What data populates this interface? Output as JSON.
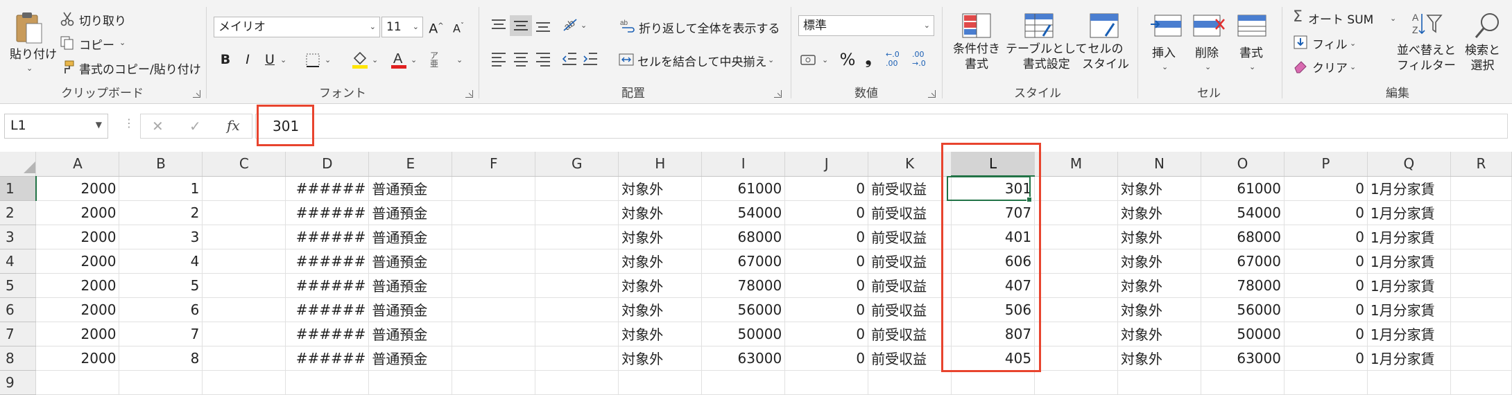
{
  "ribbon": {
    "clipboard": {
      "paste": "貼り付け",
      "cut": "切り取り",
      "copy": "コピー",
      "format_painter": "書式のコピー/貼り付け",
      "group_label": "クリップボード"
    },
    "font": {
      "font_name": "メイリオ",
      "font_size": "11",
      "bold": "B",
      "italic": "I",
      "underline": "U",
      "phonetic": "ア亜",
      "group_label": "フォント"
    },
    "alignment": {
      "wrap_text": "折り返して全体を表示する",
      "merge_center": "セルを結合して中央揃え",
      "group_label": "配置"
    },
    "number": {
      "format": "標準",
      "percent": "%",
      "comma": "❟",
      "inc_decimal": "←.0\n.00",
      "dec_decimal": ".00\n→.0",
      "group_label": "数値"
    },
    "styles": {
      "conditional": "条件付き\n書式",
      "table": "テーブルとして\n書式設定",
      "cell_style": "セルの\nスタイル",
      "group_label": "スタイル"
    },
    "cells": {
      "insert": "挿入",
      "delete": "削除",
      "format": "書式",
      "group_label": "セル"
    },
    "editing": {
      "autosum": "オート SUM",
      "fill": "フィル",
      "clear": "クリア",
      "sort_filter": "並べ替えと\nフィルター",
      "find_select": "検索と\n選択",
      "group_label": "編集"
    }
  },
  "formula_bar": {
    "name_box": "L1",
    "cancel": "✕",
    "enter": "✓",
    "fx": "fx",
    "value": "301"
  },
  "sheet": {
    "columns": [
      "A",
      "B",
      "C",
      "D",
      "E",
      "F",
      "G",
      "H",
      "I",
      "J",
      "K",
      "L",
      "M",
      "N",
      "O",
      "P",
      "Q",
      "R"
    ],
    "selected_column": "L",
    "selected_row": "1",
    "rows": [
      {
        "num": "1",
        "cells": [
          "2000",
          "1",
          "",
          "######",
          "普通預金",
          "",
          "",
          "対象外",
          "61000",
          "0",
          "前受収益",
          "301",
          "",
          "対象外",
          "61000",
          "0",
          "1月分家賃",
          ""
        ]
      },
      {
        "num": "2",
        "cells": [
          "2000",
          "2",
          "",
          "######",
          "普通預金",
          "",
          "",
          "対象外",
          "54000",
          "0",
          "前受収益",
          "707",
          "",
          "対象外",
          "54000",
          "0",
          "1月分家賃",
          ""
        ]
      },
      {
        "num": "3",
        "cells": [
          "2000",
          "3",
          "",
          "######",
          "普通預金",
          "",
          "",
          "対象外",
          "68000",
          "0",
          "前受収益",
          "401",
          "",
          "対象外",
          "68000",
          "0",
          "1月分家賃",
          ""
        ]
      },
      {
        "num": "4",
        "cells": [
          "2000",
          "4",
          "",
          "######",
          "普通預金",
          "",
          "",
          "対象外",
          "67000",
          "0",
          "前受収益",
          "606",
          "",
          "対象外",
          "67000",
          "0",
          "1月分家賃",
          ""
        ]
      },
      {
        "num": "5",
        "cells": [
          "2000",
          "5",
          "",
          "######",
          "普通預金",
          "",
          "",
          "対象外",
          "78000",
          "0",
          "前受収益",
          "407",
          "",
          "対象外",
          "78000",
          "0",
          "1月分家賃",
          ""
        ]
      },
      {
        "num": "6",
        "cells": [
          "2000",
          "6",
          "",
          "######",
          "普通預金",
          "",
          "",
          "対象外",
          "56000",
          "0",
          "前受収益",
          "506",
          "",
          "対象外",
          "56000",
          "0",
          "1月分家賃",
          ""
        ]
      },
      {
        "num": "7",
        "cells": [
          "2000",
          "7",
          "",
          "######",
          "普通預金",
          "",
          "",
          "対象外",
          "50000",
          "0",
          "前受収益",
          "807",
          "",
          "対象外",
          "50000",
          "0",
          "1月分家賃",
          ""
        ]
      },
      {
        "num": "8",
        "cells": [
          "2000",
          "8",
          "",
          "######",
          "普通預金",
          "",
          "",
          "対象外",
          "63000",
          "0",
          "前受収益",
          "405",
          "",
          "対象外",
          "63000",
          "0",
          "1月分家賃",
          ""
        ]
      },
      {
        "num": "9",
        "cells": [
          "",
          "",
          "",
          "",
          "",
          "",
          "",
          "",
          "",
          "",
          "",
          "",
          "",
          "",
          "",
          "",
          "",
          ""
        ]
      }
    ]
  },
  "colors": {
    "accent": "#217346",
    "highlight": "#e8442e"
  }
}
